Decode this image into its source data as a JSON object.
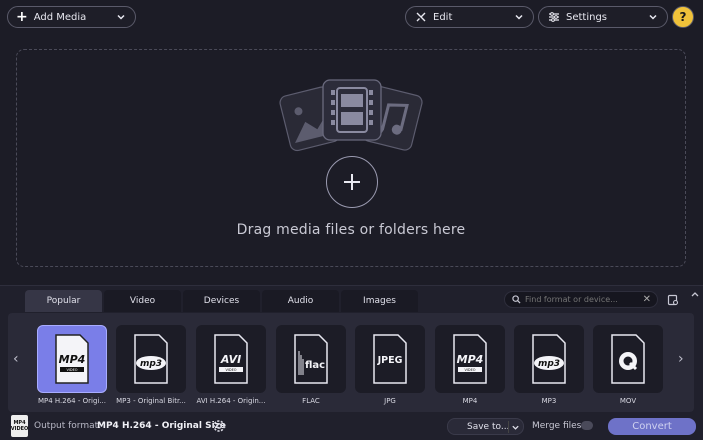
{
  "toolbar": {
    "add_media": "Add Media",
    "edit": "Edit",
    "settings": "Settings",
    "help": "?"
  },
  "dropzone": {
    "text": "Drag media files or folders here"
  },
  "tabs": [
    {
      "label": "Popular",
      "active": true
    },
    {
      "label": "Video",
      "active": false
    },
    {
      "label": "Devices",
      "active": false
    },
    {
      "label": "Audio",
      "active": false
    },
    {
      "label": "Images",
      "active": false
    }
  ],
  "search": {
    "placeholder": "Find format or device..."
  },
  "formats": [
    {
      "icon": "MP4",
      "sub": "VIDEO",
      "label": "MP4 H.264 - Origi...",
      "selected": true
    },
    {
      "icon": "mp3",
      "sub": "",
      "label": "MP3 - Original Bitr...",
      "selected": false
    },
    {
      "icon": "AVI",
      "sub": "VIDEO",
      "label": "AVI H.264 - Origin...",
      "selected": false
    },
    {
      "icon": "flac",
      "sub": "",
      "label": "FLAC",
      "selected": false
    },
    {
      "icon": "JPEG",
      "sub": "",
      "label": "JPG",
      "selected": false
    },
    {
      "icon": "MP4",
      "sub": "VIDEO",
      "label": "MP4",
      "selected": false
    },
    {
      "icon": "mp3",
      "sub": "",
      "label": "MP3",
      "selected": false
    },
    {
      "icon": "Q",
      "sub": "",
      "label": "MOV",
      "selected": false
    }
  ],
  "footer": {
    "out_icon": "MP4 VIDEO",
    "output_label": "Output format:",
    "output_value": "MP4 H.264 - Original Size",
    "save_to": "Save to...",
    "merge_label": "Merge files:",
    "convert": "Convert"
  },
  "colors": {
    "background": "#1c1c26",
    "accent": "#7a7ee8",
    "help": "#f0c23a",
    "convert": "#6e72c8"
  }
}
